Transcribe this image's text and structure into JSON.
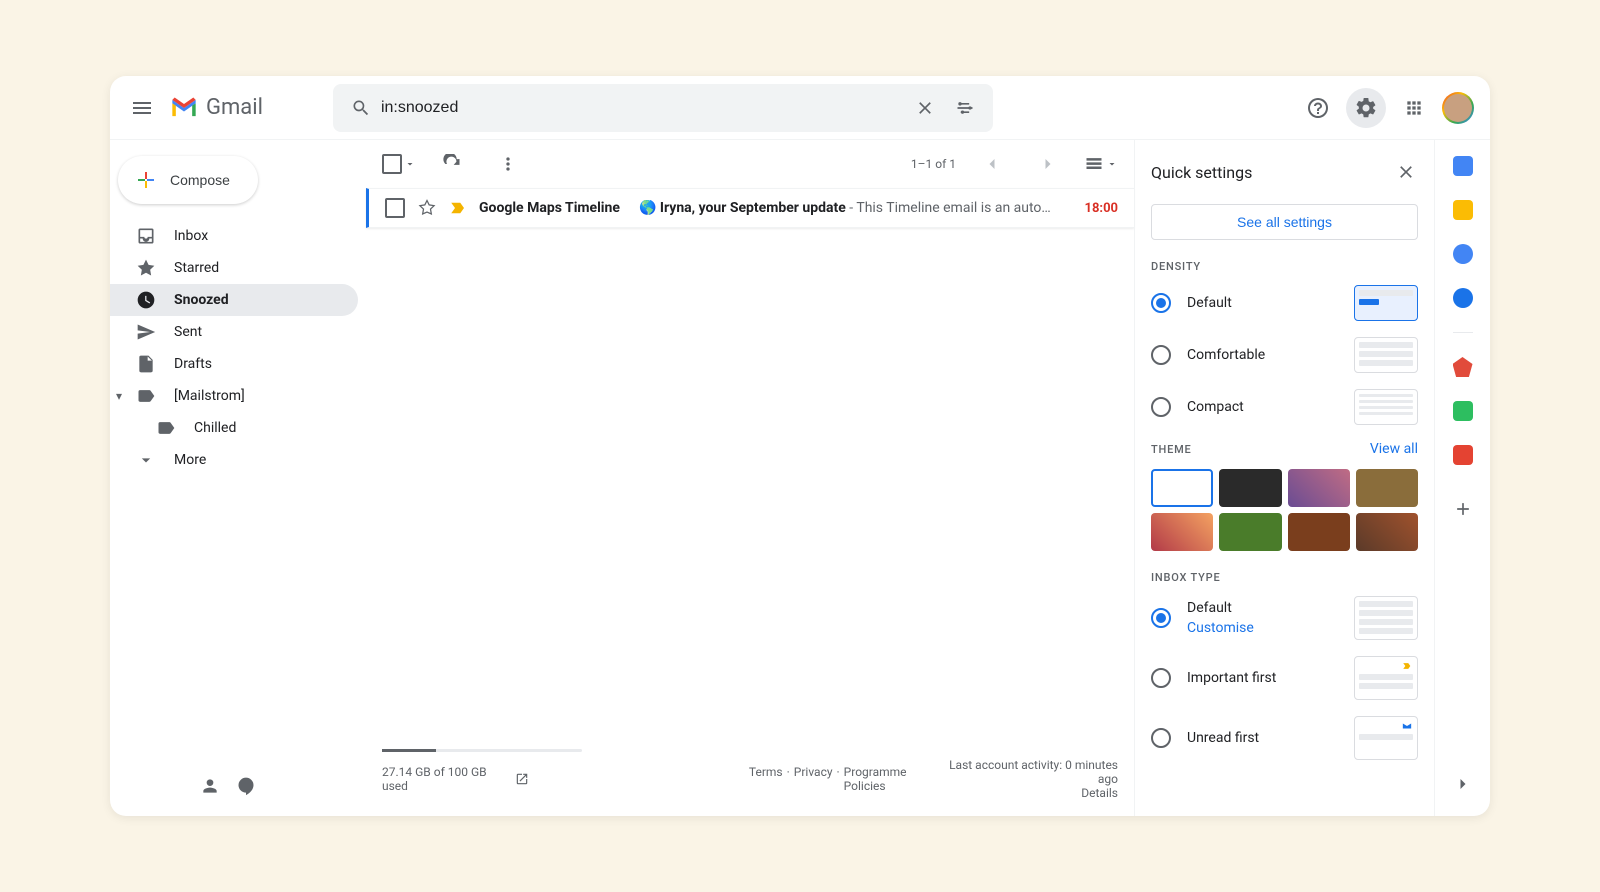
{
  "header": {
    "product_name": "Gmail",
    "search_value": "in:snoozed"
  },
  "compose_label": "Compose",
  "nav": [
    {
      "label": "Inbox"
    },
    {
      "label": "Starred"
    },
    {
      "label": "Snoozed"
    },
    {
      "label": "Sent"
    },
    {
      "label": "Drafts"
    },
    {
      "label": "[Mailstrom]"
    },
    {
      "label": "Chilled"
    },
    {
      "label": "More"
    }
  ],
  "toolbar": {
    "pagination": "1–1 of 1"
  },
  "emails": [
    {
      "sender": "Google Maps Timeline",
      "emoji": "🌎",
      "subject": "Iryna, your September update",
      "preview": " - This Timeline email is an auto…",
      "time": "18:00"
    }
  ],
  "footer": {
    "storage": "27.14 GB of 100 GB used",
    "terms": "Terms",
    "privacy": "Privacy",
    "policies": "Programme Policies",
    "activity": "Last account activity: 0 minutes ago",
    "details": "Details"
  },
  "quick_settings": {
    "title": "Quick settings",
    "see_all": "See all settings",
    "density_label": "DENSITY",
    "density": [
      {
        "label": "Default"
      },
      {
        "label": "Comfortable"
      },
      {
        "label": "Compact"
      }
    ],
    "theme_label": "THEME",
    "view_all": "View all",
    "inbox_label": "INBOX TYPE",
    "inbox": [
      {
        "label": "Default",
        "customise": "Customise"
      },
      {
        "label": "Important first"
      },
      {
        "label": "Unread first"
      }
    ]
  },
  "theme_colors": [
    "#ffffff",
    "#333333",
    "#6a4c93",
    "#8a6d3b",
    "#b23a48",
    "#4a7c2a",
    "#7a3e1d",
    "#5b3a29"
  ]
}
